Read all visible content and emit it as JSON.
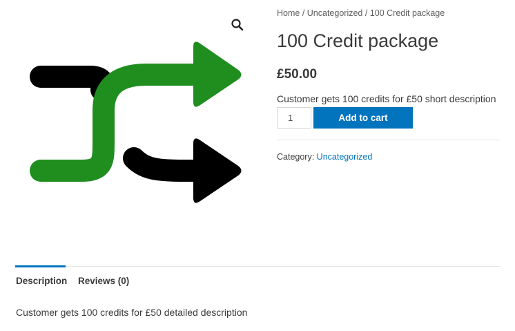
{
  "breadcrumb": {
    "home": "Home",
    "sep1": " / ",
    "category": "Uncategorized",
    "sep2": " / ",
    "current": "100 Credit package"
  },
  "product": {
    "title": "100 Credit package",
    "price": "£50.00",
    "short_description": "Customer gets 100 credits for £50 short description",
    "quantity": "1",
    "add_to_cart_label": "Add to cart",
    "category_label": "Category: ",
    "category_value": "Uncategorized",
    "image_icon": "shuffle-arrows-icon",
    "zoom_icon": "search-icon"
  },
  "tabs": [
    {
      "label": "Description",
      "active": true
    },
    {
      "label": "Reviews (0)",
      "active": false
    }
  ],
  "tab_panel": {
    "text": "Customer gets 100 credits for £50 detailed description"
  },
  "colors": {
    "accent": "#0274be",
    "green": "#1f8e1f",
    "black": "#000000"
  }
}
